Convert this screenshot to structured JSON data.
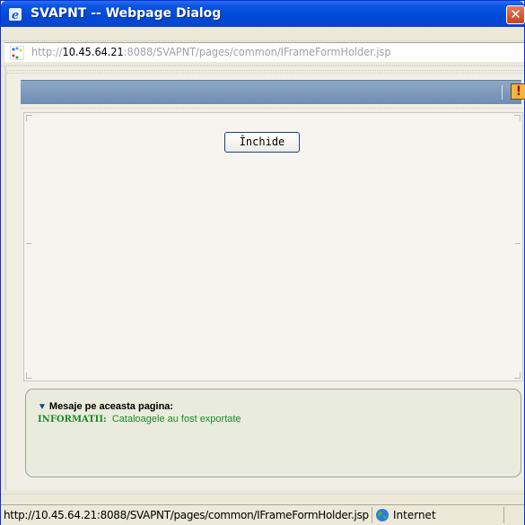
{
  "window": {
    "title": "SVAPNT -- Webpage Dialog",
    "close_glyph": "✕",
    "icon": "ie-icon"
  },
  "address": {
    "prefix": "http://",
    "host": "10.45.64.21",
    "suffix": ":8088/SVAPNT/pages/common/IFrameFormHolder.jsp",
    "icon": "loading-page-icon"
  },
  "toolbar": {
    "alert_label": "!",
    "alert_color": "#f0b640"
  },
  "dialog": {
    "close_button_label": "Închide"
  },
  "messages": {
    "header": "Mesaje pe aceasta pagina:",
    "items": [
      {
        "type": "INFORMATII:",
        "text": "Cataloagele au fost exportate"
      }
    ],
    "info_color": "#1a8a2a"
  },
  "status": {
    "url": "http://10.45.64.21:8088/SVAPNT/pages/common/IFrameFormHolder.jsp",
    "zone": "Internet",
    "zone_icon": "globe-icon"
  },
  "colors": {
    "titlebar": "#0049d8",
    "band": "#7b98bb"
  }
}
